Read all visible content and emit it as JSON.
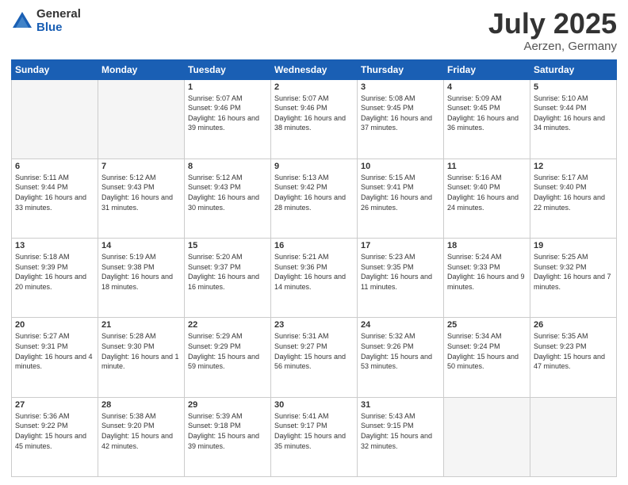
{
  "logo": {
    "general": "General",
    "blue": "Blue"
  },
  "title": {
    "month": "July 2025",
    "location": "Aerzen, Germany"
  },
  "weekdays": [
    "Sunday",
    "Monday",
    "Tuesday",
    "Wednesday",
    "Thursday",
    "Friday",
    "Saturday"
  ],
  "weeks": [
    [
      {
        "day": "",
        "info": ""
      },
      {
        "day": "",
        "info": ""
      },
      {
        "day": "1",
        "info": "Sunrise: 5:07 AM\nSunset: 9:46 PM\nDaylight: 16 hours and 39 minutes."
      },
      {
        "day": "2",
        "info": "Sunrise: 5:07 AM\nSunset: 9:46 PM\nDaylight: 16 hours and 38 minutes."
      },
      {
        "day": "3",
        "info": "Sunrise: 5:08 AM\nSunset: 9:45 PM\nDaylight: 16 hours and 37 minutes."
      },
      {
        "day": "4",
        "info": "Sunrise: 5:09 AM\nSunset: 9:45 PM\nDaylight: 16 hours and 36 minutes."
      },
      {
        "day": "5",
        "info": "Sunrise: 5:10 AM\nSunset: 9:44 PM\nDaylight: 16 hours and 34 minutes."
      }
    ],
    [
      {
        "day": "6",
        "info": "Sunrise: 5:11 AM\nSunset: 9:44 PM\nDaylight: 16 hours and 33 minutes."
      },
      {
        "day": "7",
        "info": "Sunrise: 5:12 AM\nSunset: 9:43 PM\nDaylight: 16 hours and 31 minutes."
      },
      {
        "day": "8",
        "info": "Sunrise: 5:12 AM\nSunset: 9:43 PM\nDaylight: 16 hours and 30 minutes."
      },
      {
        "day": "9",
        "info": "Sunrise: 5:13 AM\nSunset: 9:42 PM\nDaylight: 16 hours and 28 minutes."
      },
      {
        "day": "10",
        "info": "Sunrise: 5:15 AM\nSunset: 9:41 PM\nDaylight: 16 hours and 26 minutes."
      },
      {
        "day": "11",
        "info": "Sunrise: 5:16 AM\nSunset: 9:40 PM\nDaylight: 16 hours and 24 minutes."
      },
      {
        "day": "12",
        "info": "Sunrise: 5:17 AM\nSunset: 9:40 PM\nDaylight: 16 hours and 22 minutes."
      }
    ],
    [
      {
        "day": "13",
        "info": "Sunrise: 5:18 AM\nSunset: 9:39 PM\nDaylight: 16 hours and 20 minutes."
      },
      {
        "day": "14",
        "info": "Sunrise: 5:19 AM\nSunset: 9:38 PM\nDaylight: 16 hours and 18 minutes."
      },
      {
        "day": "15",
        "info": "Sunrise: 5:20 AM\nSunset: 9:37 PM\nDaylight: 16 hours and 16 minutes."
      },
      {
        "day": "16",
        "info": "Sunrise: 5:21 AM\nSunset: 9:36 PM\nDaylight: 16 hours and 14 minutes."
      },
      {
        "day": "17",
        "info": "Sunrise: 5:23 AM\nSunset: 9:35 PM\nDaylight: 16 hours and 11 minutes."
      },
      {
        "day": "18",
        "info": "Sunrise: 5:24 AM\nSunset: 9:33 PM\nDaylight: 16 hours and 9 minutes."
      },
      {
        "day": "19",
        "info": "Sunrise: 5:25 AM\nSunset: 9:32 PM\nDaylight: 16 hours and 7 minutes."
      }
    ],
    [
      {
        "day": "20",
        "info": "Sunrise: 5:27 AM\nSunset: 9:31 PM\nDaylight: 16 hours and 4 minutes."
      },
      {
        "day": "21",
        "info": "Sunrise: 5:28 AM\nSunset: 9:30 PM\nDaylight: 16 hours and 1 minute."
      },
      {
        "day": "22",
        "info": "Sunrise: 5:29 AM\nSunset: 9:29 PM\nDaylight: 15 hours and 59 minutes."
      },
      {
        "day": "23",
        "info": "Sunrise: 5:31 AM\nSunset: 9:27 PM\nDaylight: 15 hours and 56 minutes."
      },
      {
        "day": "24",
        "info": "Sunrise: 5:32 AM\nSunset: 9:26 PM\nDaylight: 15 hours and 53 minutes."
      },
      {
        "day": "25",
        "info": "Sunrise: 5:34 AM\nSunset: 9:24 PM\nDaylight: 15 hours and 50 minutes."
      },
      {
        "day": "26",
        "info": "Sunrise: 5:35 AM\nSunset: 9:23 PM\nDaylight: 15 hours and 47 minutes."
      }
    ],
    [
      {
        "day": "27",
        "info": "Sunrise: 5:36 AM\nSunset: 9:22 PM\nDaylight: 15 hours and 45 minutes."
      },
      {
        "day": "28",
        "info": "Sunrise: 5:38 AM\nSunset: 9:20 PM\nDaylight: 15 hours and 42 minutes."
      },
      {
        "day": "29",
        "info": "Sunrise: 5:39 AM\nSunset: 9:18 PM\nDaylight: 15 hours and 39 minutes."
      },
      {
        "day": "30",
        "info": "Sunrise: 5:41 AM\nSunset: 9:17 PM\nDaylight: 15 hours and 35 minutes."
      },
      {
        "day": "31",
        "info": "Sunrise: 5:43 AM\nSunset: 9:15 PM\nDaylight: 15 hours and 32 minutes."
      },
      {
        "day": "",
        "info": ""
      },
      {
        "day": "",
        "info": ""
      }
    ]
  ]
}
